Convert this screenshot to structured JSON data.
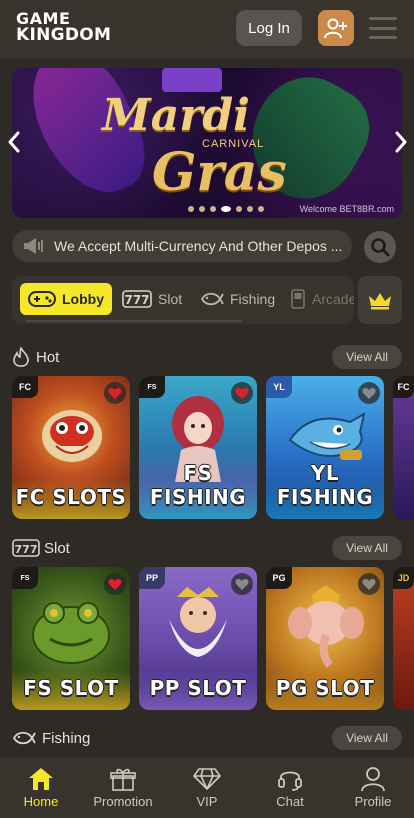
{
  "header": {
    "logo_line1": "GAME",
    "logo_line2": "KINGDOM",
    "login_label": "Log In"
  },
  "banner": {
    "title_line1": "Mardi",
    "subtitle": "CARNIVAL",
    "title_line2": "Gras",
    "welcome": "Welcome BET8BR.com"
  },
  "marquee": {
    "text": "We Accept Multi-Currency And Other Depos ..."
  },
  "tabs": [
    {
      "label": "Lobby",
      "icon": "gamepad-icon",
      "active": true
    },
    {
      "label": "Slot",
      "icon": "slot-777-icon",
      "active": false
    },
    {
      "label": "Fishing",
      "icon": "fish-icon",
      "active": false
    },
    {
      "label": "Arcade",
      "icon": "arcade-icon",
      "active": false
    }
  ],
  "sections": {
    "hot": {
      "title": "Hot",
      "view_all": "View All",
      "cards": [
        {
          "label": "FC SLOTS",
          "provider": "FC",
          "favorited": true
        },
        {
          "label": "FS FISHING",
          "provider": "FS",
          "favorited": true
        },
        {
          "label": "YL FISHING",
          "provider": "YL",
          "favorited": false
        },
        {
          "label": "",
          "provider": "FC",
          "favorited": false
        }
      ]
    },
    "slot": {
      "title": "Slot",
      "view_all": "View All",
      "cards": [
        {
          "label": "FS SLOT",
          "provider": "FS",
          "favorited": true
        },
        {
          "label": "PP SLOT",
          "provider": "PP",
          "favorited": false
        },
        {
          "label": "PG SLOT",
          "provider": "PG",
          "favorited": false
        },
        {
          "label": "",
          "provider": "JD",
          "favorited": false
        }
      ]
    },
    "fishing": {
      "title": "Fishing",
      "view_all": "View All"
    }
  },
  "bottom_nav": [
    {
      "label": "Home",
      "icon": "home-icon",
      "active": true
    },
    {
      "label": "Promotion",
      "icon": "gift-icon",
      "active": false
    },
    {
      "label": "VIP",
      "icon": "diamond-icon",
      "active": false
    },
    {
      "label": "Chat",
      "icon": "headset-icon",
      "active": false
    },
    {
      "label": "Profile",
      "icon": "user-icon",
      "active": false
    }
  ],
  "colors": {
    "background": "#2e2a26",
    "header": "#39332d",
    "accent_yellow": "#f5e82a",
    "register_orange": "#c98a4a",
    "heart_red": "#e0202a"
  }
}
